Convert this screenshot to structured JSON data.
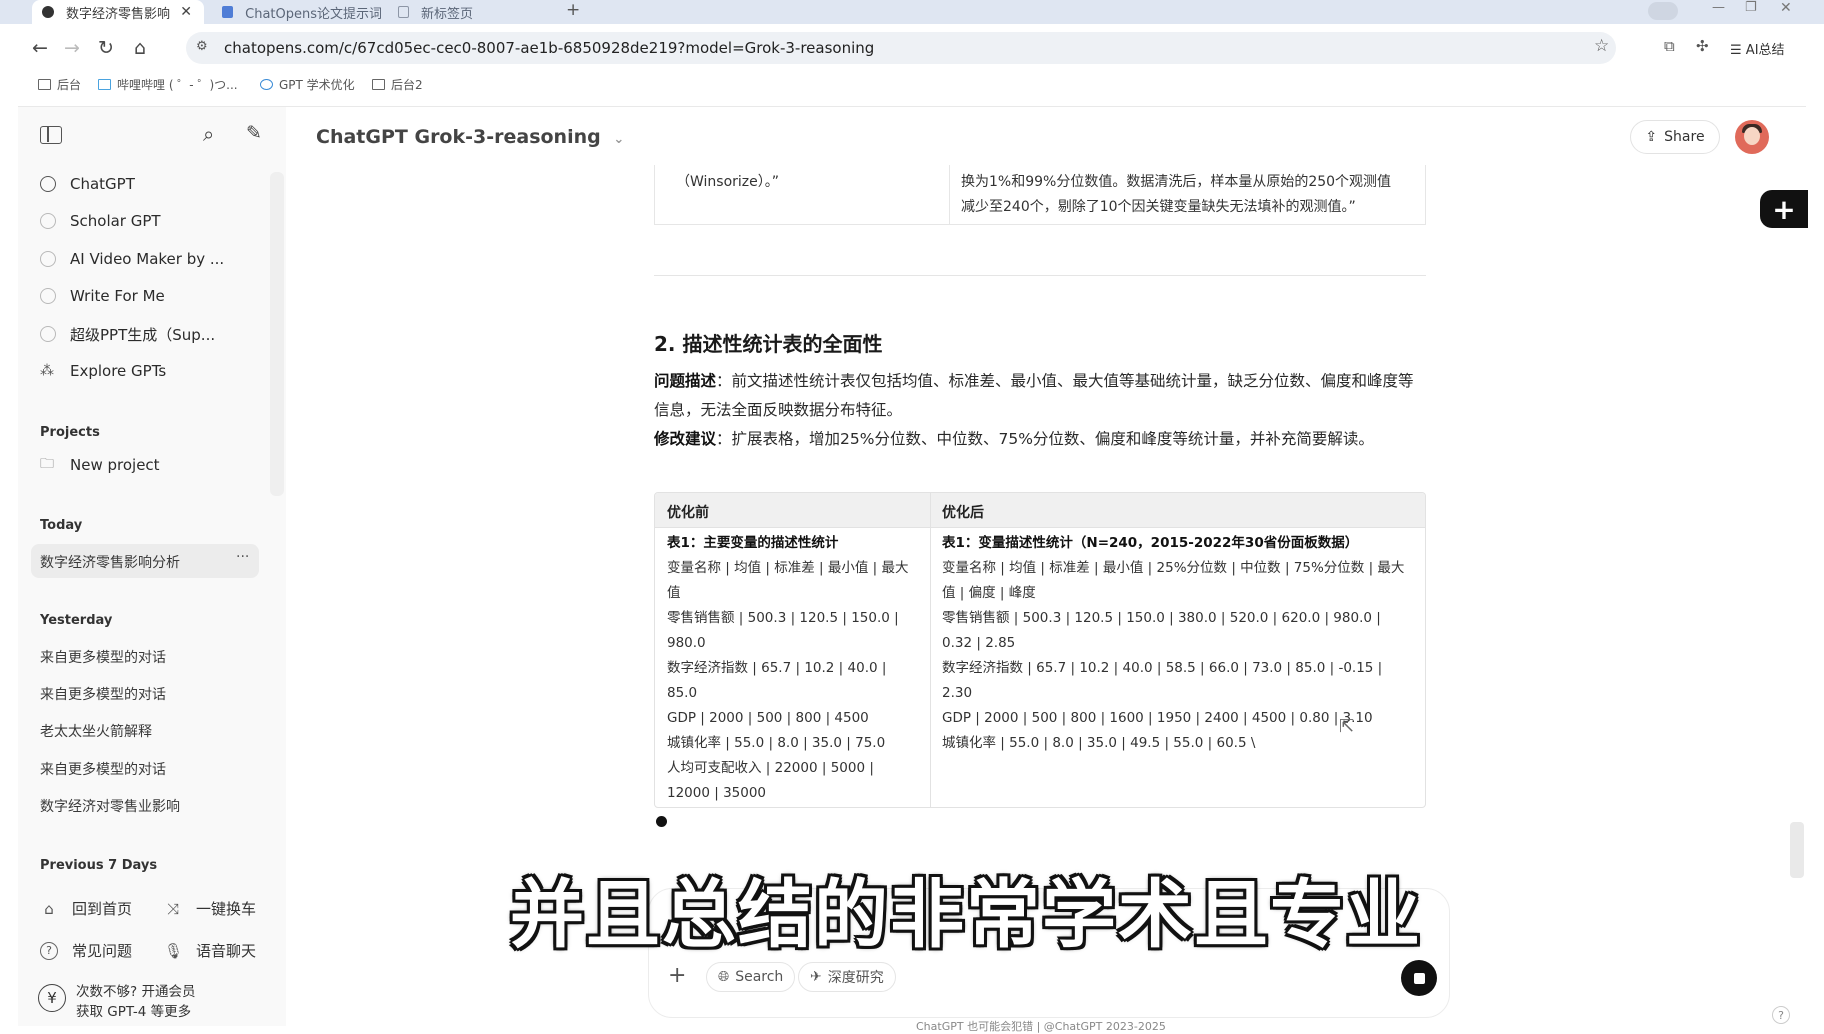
{
  "browser": {
    "tabs": [
      {
        "label": "数字经济零售影响"
      },
      {
        "label": "ChatOpens论文提示词"
      },
      {
        "label": "新标签页"
      }
    ],
    "new_tab": "+",
    "url": "chatopens.com/c/67cd05ec-cec0-8007-ae1b-6850928de219?model=Grok-3-reasoning",
    "ai_summary": "AI总结",
    "bookmarks": [
      {
        "label": "后台"
      },
      {
        "label": "哔哩哔哩 ( ゜- ゜)つ..."
      },
      {
        "label": "GPT 学术优化"
      },
      {
        "label": "后台2"
      }
    ]
  },
  "sidebar": {
    "gpts": [
      {
        "label": "ChatGPT"
      },
      {
        "label": "Scholar GPT"
      },
      {
        "label": "AI Video Maker by ..."
      },
      {
        "label": "Write For Me"
      },
      {
        "label": "超级PPT生成（Sup..."
      },
      {
        "label": "Explore GPTs"
      }
    ],
    "projects_heading": "Projects",
    "new_project": "New project",
    "today_heading": "Today",
    "today_items": [
      {
        "label": "数字经济零售影响分析"
      }
    ],
    "more": "···",
    "yesterday_heading": "Yesterday",
    "yesterday_items": [
      {
        "label": "来自更多模型的对话"
      },
      {
        "label": "来自更多模型的对话"
      },
      {
        "label": "老太太坐火箭解释"
      },
      {
        "label": "来自更多模型的对话"
      },
      {
        "label": "数字经济对零售业影响"
      }
    ],
    "previous_heading": "Previous 7 Days",
    "bottom": {
      "home": "回到首页",
      "switch": "一键换车",
      "faq": "常见问题",
      "voice": "语音聊天",
      "upgrade_line1": "次数不够? 开通会员",
      "upgrade_line2": "获取 GPT-4 等更多"
    }
  },
  "header": {
    "model": "ChatGPT Grok-3-reasoning",
    "share": "Share"
  },
  "content": {
    "prev_left": "（Winsorize）。”",
    "prev_right_1": "换为1%和99%分位数值。数据清洗后，样本量从原始的250个观测值",
    "prev_right_2": "减少至240个，剔除了10个因关键变量缺失无法填补的观测值。”",
    "section_title": "2. 描述性统计表的全面性",
    "problem_label": "问题描述",
    "problem_text": "：前文描述性统计表仅包括均值、标准差、最小值、最大值等基础统计量，缺乏分位数、偏度和峰度等信息，无法全面反映数据分布特征。",
    "suggest_label": "修改建议",
    "suggest_text": "：扩展表格，增加25%分位数、中位数、75%分位数、偏度和峰度等统计量，并补充简要解读。",
    "table": {
      "col_before": "优化前",
      "col_after": "优化后",
      "before_title": "表1：主要变量的描述性统计",
      "before_lines": [
        "变量名称 | 均值 | 标准差 | 最小值 | 最大值",
        "零售销售额 | 500.3 | 120.5 | 150.0 | 980.0",
        "数字经济指数 | 65.7 | 10.2 | 40.0 | 85.0",
        "GDP | 2000 | 500 | 800 | 4500",
        "城镇化率 | 55.0 | 8.0 | 35.0 | 75.0",
        "人均可支配收入 | 22000 | 5000 | 12000 | 35000"
      ],
      "after_title": "表1：变量描述性统计（N=240，2015-2022年30省份面板数据）",
      "after_lines": [
        "变量名称 | 均值 | 标准差 | 最小值 | 25%分位数 | 中位数 | 75%分位数 | 最大值 | 偏度 | 峰度",
        "零售销售额 | 500.3 | 120.5 | 150.0 | 380.0 | 520.0 | 620.0 | 980.0 | 0.32 | 2.85",
        "数字经济指数 | 65.7 | 10.2 | 40.0 | 58.5 | 66.0 | 73.0 | 85.0 | -0.15 | 2.30",
        "GDP | 2000 | 500 | 800 | 1600 | 1950 | 2400 | 4500 | 0.80 | 3.10",
        "城镇化率 | 55.0 | 8.0 | 35.0 | 49.5 | 55.0 | 60.5 \\"
      ]
    }
  },
  "subtitle": "并且总结的非常学术且专业",
  "composer": {
    "search": "Search",
    "deep_research": "深度研究"
  },
  "footer": "ChatGPT 也可能会犯错 | @ChatGPT 2023-2025"
}
